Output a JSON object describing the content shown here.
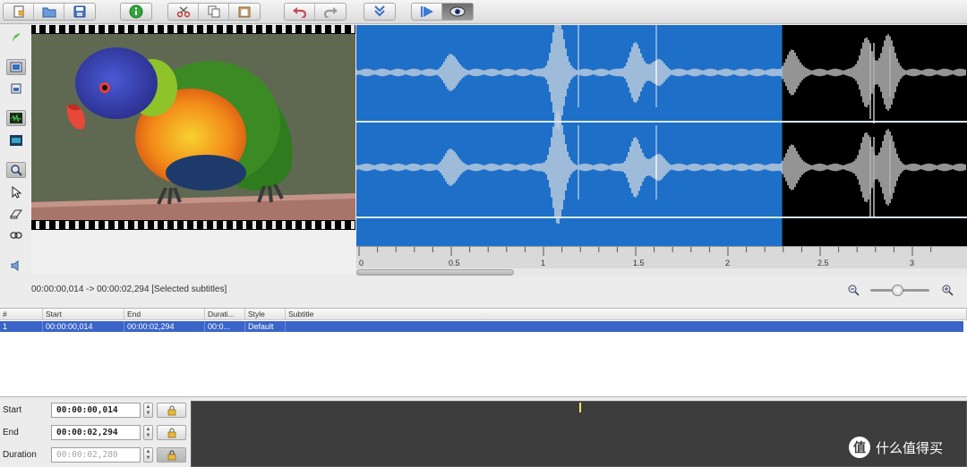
{
  "toolbar": {
    "groups": [
      {
        "name": "file",
        "buttons": [
          "new-icon",
          "open-icon",
          "save-icon"
        ]
      },
      {
        "name": "info",
        "buttons": [
          "info-icon"
        ]
      },
      {
        "name": "edit",
        "buttons": [
          "cut-icon",
          "copy-icon",
          "paste-icon"
        ]
      },
      {
        "name": "history",
        "buttons": [
          "undo-icon",
          "redo-icon"
        ]
      },
      {
        "name": "merge",
        "buttons": [
          "merge-icon"
        ]
      },
      {
        "name": "playback",
        "buttons": [
          "play-icon",
          "eye-icon"
        ]
      }
    ],
    "pressed": "eye-icon"
  },
  "left_tools": [
    "plugin-icon",
    "video-view-icon",
    "video-small-icon",
    "waveform-icon",
    "spectrum-icon",
    "zoom-tool-icon",
    "pointer-tool-icon",
    "eraser-tool-icon",
    "link-tool-icon",
    "speaker-icon",
    "media-icon"
  ],
  "waveform": {
    "ruler_labels": [
      "0",
      "0.5",
      "1",
      "1.5",
      "2",
      "2.5",
      "3"
    ],
    "selection_start_s": 0.014,
    "selection_end_s": 2.294,
    "visible_end_s": 3.1,
    "selection_color": "#1e6fc8"
  },
  "status": {
    "selection_text": "00:00:00,014 -> 00:00:02,294 [Selected subtitles]",
    "zoom_level": 0.45
  },
  "table": {
    "columns": [
      "#",
      "Start",
      "End",
      "Durati...",
      "Style",
      "Subtitle"
    ],
    "rows": [
      {
        "index": "1",
        "start": "00:00:00,014",
        "end": "00:00:02,294",
        "duration": "00:0...",
        "style": "Default",
        "subtitle": ""
      }
    ]
  },
  "editor": {
    "start_label": "Start",
    "start_value": "00:00:00,014",
    "end_label": "End",
    "end_value": "00:00:02,294",
    "duration_label": "Duration",
    "duration_value": "00:00:02,280"
  },
  "watermark": {
    "logo_text": "值",
    "text": "什么值得买"
  },
  "colors": {
    "accent": "#3a64c8",
    "waveform_selection": "#1e6fc8",
    "waveform_bg": "#000000",
    "cursor_yellow": "#e8e85a"
  }
}
